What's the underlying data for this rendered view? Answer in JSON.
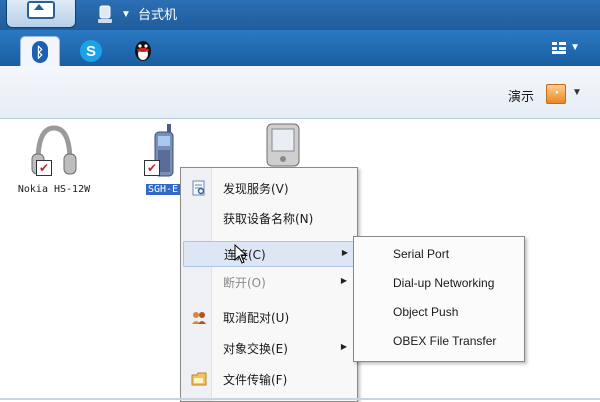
{
  "topbar": {
    "title": "台式机"
  },
  "toolbar": {
    "demo_label": "演示"
  },
  "devices": [
    {
      "name": "Nokia HS-12W",
      "checked": true
    },
    {
      "name": "SGH-E",
      "checked": true,
      "selected": true
    },
    {
      "name": "",
      "checked": false
    }
  ],
  "context_menu": {
    "items": [
      {
        "label": "发现服务(V)"
      },
      {
        "label": "获取设备名称(N)"
      },
      {
        "label": "连接(C)",
        "has_submenu": true,
        "highlighted": true
      },
      {
        "label": "断开(O)",
        "has_submenu": true,
        "disabled": true
      },
      {
        "label": "取消配对(U)"
      },
      {
        "label": "对象交换(E)",
        "has_submenu": true
      },
      {
        "label": "文件传输(F)"
      }
    ]
  },
  "submenu": {
    "items": [
      {
        "label": "Serial Port"
      },
      {
        "label": "Dial-up Networking"
      },
      {
        "label": "Object Push"
      },
      {
        "label": "OBEX File Transfer"
      }
    ]
  },
  "colors": {
    "title_bar": "#1f5c9c",
    "tab_bar": "#2a79c3",
    "selection": "#316ac5",
    "menu_highlight": "#dde6f4"
  },
  "icons": {
    "home": "up-arrow-icon",
    "device": "computer-icon",
    "tab1": "bluetooth-icon",
    "tab2": "skype-icon",
    "tab3": "qq-penguin-icon",
    "view": "view-options-icon",
    "demo": "demo-icon"
  }
}
